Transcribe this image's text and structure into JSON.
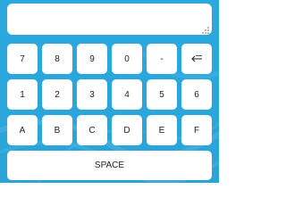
{
  "display": {
    "value": "",
    "placeholder": ""
  },
  "keys": {
    "row1": [
      {
        "label": "7"
      },
      {
        "label": "8"
      },
      {
        "label": "9"
      },
      {
        "label": "0"
      },
      {
        "label": "-"
      },
      {
        "icon": "backspace-icon"
      }
    ],
    "row2": [
      {
        "label": "1"
      },
      {
        "label": "2"
      },
      {
        "label": "3"
      },
      {
        "label": "4"
      },
      {
        "label": "5"
      },
      {
        "label": "6"
      }
    ],
    "row3": [
      {
        "label": "A"
      },
      {
        "label": "B"
      },
      {
        "label": "C"
      },
      {
        "label": "D"
      },
      {
        "label": "E"
      },
      {
        "label": "F"
      }
    ],
    "space": {
      "label": "SPACE"
    }
  },
  "colors": {
    "background": "#2ba9df",
    "key": "#ffffff",
    "text": "#222222"
  }
}
